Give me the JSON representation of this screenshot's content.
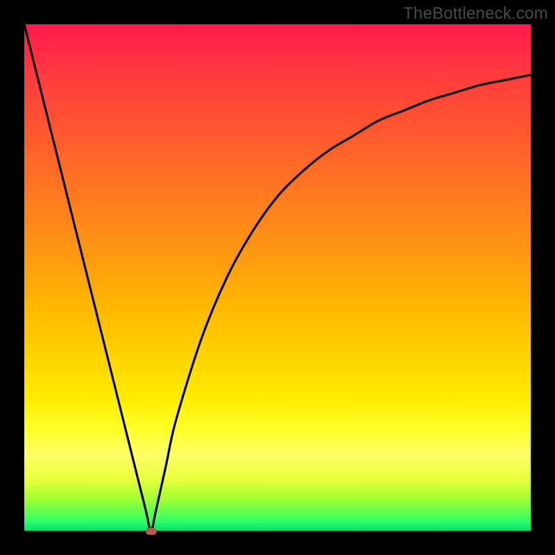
{
  "watermark": "TheBottleneck.com",
  "colors": {
    "top": "#ff1a4d",
    "mid": "#ffd400",
    "bottom": "#00e070",
    "curve": "#000000",
    "marker": "#bb5a4a",
    "frame": "#000000"
  },
  "chart_data": {
    "type": "line",
    "title": "",
    "xlabel": "",
    "ylabel": "",
    "xlim": [
      0,
      100
    ],
    "ylim": [
      0,
      100
    ],
    "x": [
      0,
      5,
      10,
      15,
      20,
      22,
      24,
      25,
      26,
      28,
      30,
      35,
      40,
      45,
      50,
      55,
      60,
      65,
      70,
      75,
      80,
      85,
      90,
      95,
      100
    ],
    "values": [
      100,
      80,
      60,
      40,
      20,
      12,
      4,
      0,
      4,
      13,
      22,
      38,
      50,
      59,
      66,
      71,
      75,
      78,
      81,
      83,
      85,
      86.5,
      88,
      89,
      90
    ],
    "minimum": {
      "x": 25,
      "y": 0
    },
    "annotations": [],
    "grid": false,
    "legend": false
  }
}
